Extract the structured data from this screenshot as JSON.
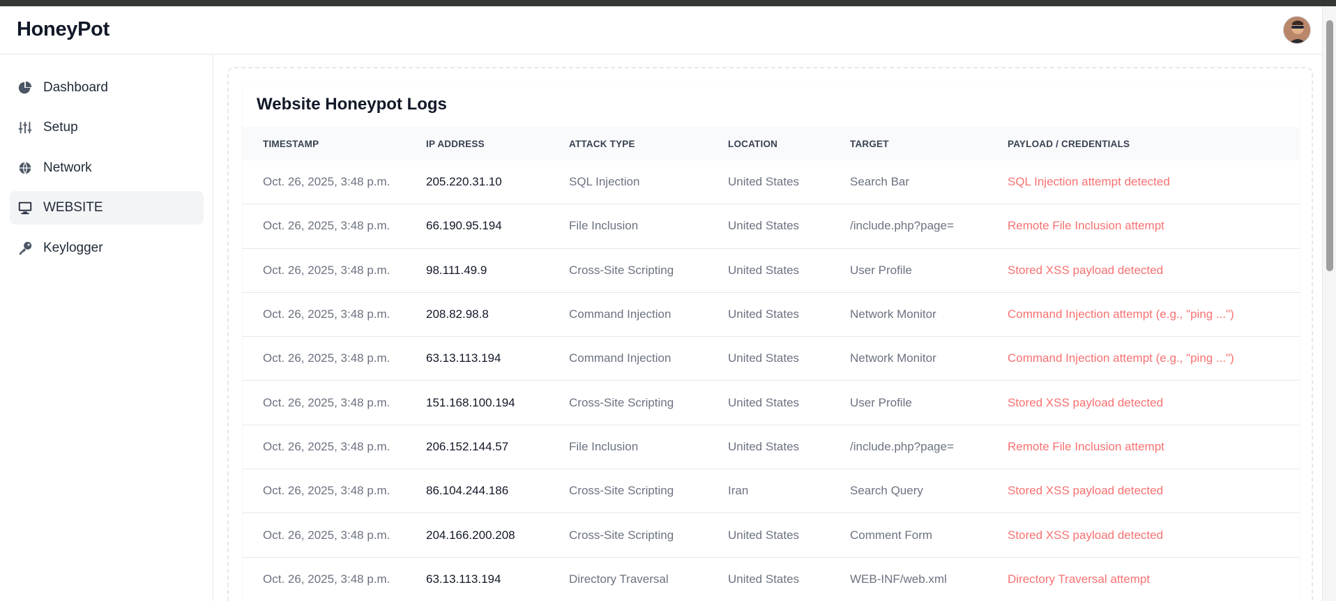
{
  "app": {
    "title": "HoneyPot"
  },
  "sidebar": {
    "items": [
      {
        "label": "Dashboard",
        "icon": "pie-chart-icon"
      },
      {
        "label": "Setup",
        "icon": "sliders-icon"
      },
      {
        "label": "Network",
        "icon": "globe-icon"
      },
      {
        "label": "WEBSITE",
        "icon": "monitor-icon",
        "active": true
      },
      {
        "label": "Keylogger",
        "icon": "key-icon"
      }
    ]
  },
  "main": {
    "title": "Website Honeypot Logs",
    "columns": [
      "TIMESTAMP",
      "IP ADDRESS",
      "ATTACK TYPE",
      "LOCATION",
      "TARGET",
      "PAYLOAD / CREDENTIALS"
    ],
    "rows": [
      [
        "Oct. 26, 2025, 3:48 p.m.",
        "205.220.31.10",
        "SQL Injection",
        "United States",
        "Search Bar",
        "SQL Injection attempt detected"
      ],
      [
        "Oct. 26, 2025, 3:48 p.m.",
        "66.190.95.194",
        "File Inclusion",
        "United States",
        "/include.php?page=",
        "Remote File Inclusion attempt"
      ],
      [
        "Oct. 26, 2025, 3:48 p.m.",
        "98.111.49.9",
        "Cross-Site Scripting",
        "United States",
        "User Profile",
        "Stored XSS payload detected"
      ],
      [
        "Oct. 26, 2025, 3:48 p.m.",
        "208.82.98.8",
        "Command Injection",
        "United States",
        "Network Monitor",
        "Command Injection attempt (e.g., \"ping ...\")"
      ],
      [
        "Oct. 26, 2025, 3:48 p.m.",
        "63.13.113.194",
        "Command Injection",
        "United States",
        "Network Monitor",
        "Command Injection attempt (e.g., \"ping ...\")"
      ],
      [
        "Oct. 26, 2025, 3:48 p.m.",
        "151.168.100.194",
        "Cross-Site Scripting",
        "United States",
        "User Profile",
        "Stored XSS payload detected"
      ],
      [
        "Oct. 26, 2025, 3:48 p.m.",
        "206.152.144.57",
        "File Inclusion",
        "United States",
        "/include.php?page=",
        "Remote File Inclusion attempt"
      ],
      [
        "Oct. 26, 2025, 3:48 p.m.",
        "86.104.244.186",
        "Cross-Site Scripting",
        "Iran",
        "Search Query",
        "Stored XSS payload detected"
      ],
      [
        "Oct. 26, 2025, 3:48 p.m.",
        "204.166.200.208",
        "Cross-Site Scripting",
        "United States",
        "Comment Form",
        "Stored XSS payload detected"
      ],
      [
        "Oct. 26, 2025, 3:48 p.m.",
        "63.13.113.194",
        "Directory Traversal",
        "United States",
        "WEB-INF/web.xml",
        "Directory Traversal attempt"
      ]
    ]
  },
  "colors": {
    "payload_text": "#f87171",
    "header_bg": "#f9fafb",
    "active_nav_bg": "#f3f4f6"
  }
}
